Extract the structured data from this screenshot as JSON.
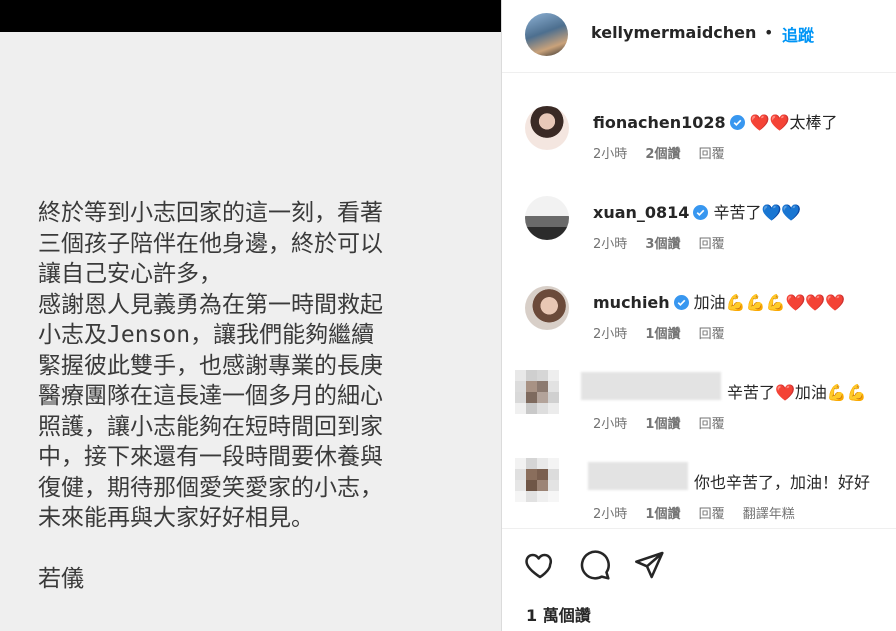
{
  "post": {
    "lines": [
      "終於等到小志回家的這一刻，看著",
      "三個孩子陪伴在他身邊，終於可以",
      "讓自己安心許多，",
      "感謝恩人見義勇為在第一時間救起",
      "小志及Jenson，讓我們能夠繼續",
      "緊握彼此雙手，也感謝專業的長庚",
      "醫療團隊在這長達一個多月的細心",
      "照護，讓小志能夠在短時間回到家",
      "中，接下來還有一段時間要休養與",
      "復健，期待那個愛笑愛家的小志，",
      "未來能再與大家好好相見。"
    ],
    "signature": "若儀"
  },
  "header": {
    "username": "kellymermaidchen",
    "dot": "•",
    "follow_label": "追蹤"
  },
  "comments": [
    {
      "username": "fionachen1028",
      "verified": true,
      "text": "❤️❤️太棒了",
      "time": "2小時",
      "likes": "2個讚",
      "reply": "回覆"
    },
    {
      "username": "xuan_0814",
      "verified": true,
      "text": "辛苦了💙💙",
      "time": "2小時",
      "likes": "3個讚",
      "reply": "回覆"
    },
    {
      "username": "muchieh",
      "verified": true,
      "text": "加油💪💪💪❤️❤️❤️",
      "time": "2小時",
      "likes": "1個讚",
      "reply": "回覆"
    },
    {
      "username": "",
      "verified": false,
      "text": "辛苦了❤️加油💪💪",
      "time": "2小時",
      "likes": "1個讚",
      "reply": "回覆"
    },
    {
      "username": "",
      "verified": false,
      "text": "你也辛苦了，加油！好好",
      "time": "2小時",
      "likes": "1個讚",
      "reply": "回覆",
      "translate": "翻譯年糕"
    }
  ],
  "footer": {
    "likes_total": "1 萬個讚"
  },
  "icons": {
    "like": "heart-icon",
    "comment": "comment-bubble-icon",
    "share": "paper-plane-icon",
    "verified": "verified-badge-icon"
  },
  "colors": {
    "follow": "#0095f6",
    "verified": "#3897f0",
    "meta": "#737373"
  }
}
